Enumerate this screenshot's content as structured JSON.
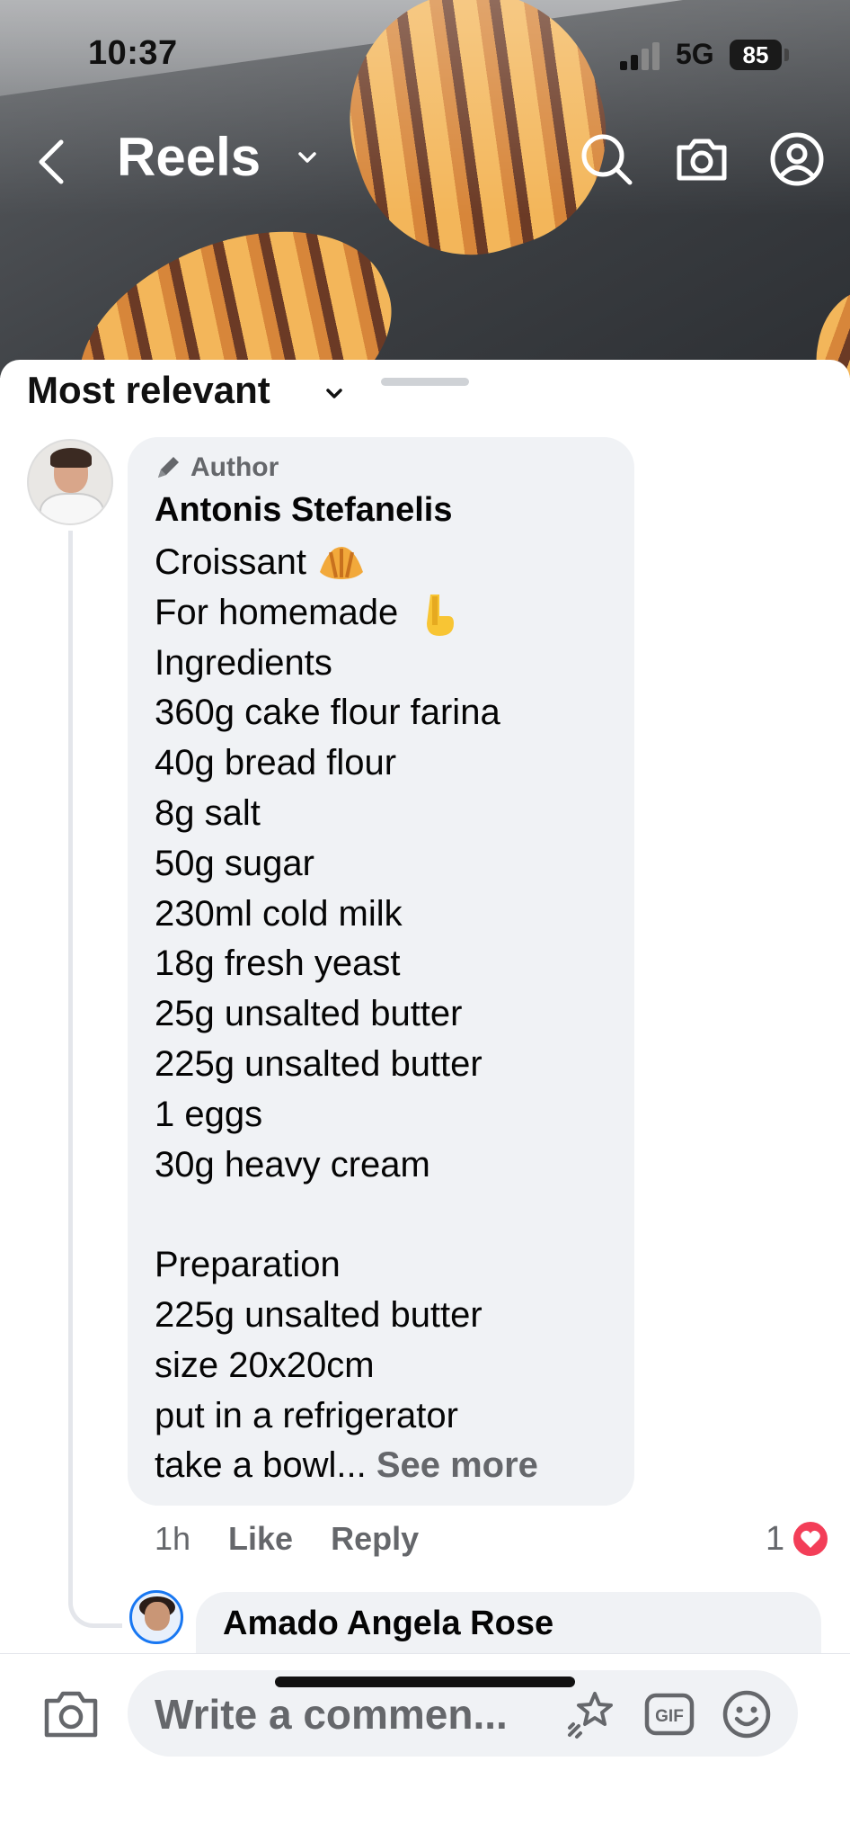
{
  "status_bar": {
    "time": "10:37",
    "network": "5G",
    "battery": "85"
  },
  "header": {
    "title": "Reels"
  },
  "comments": {
    "sort_label": "Most relevant",
    "main": {
      "badge": "Author",
      "name": "Antonis Stefanelis",
      "lines": [
        "Croissant",
        "For homemade",
        "Ingredients",
        "360g cake flour farina",
        "40g bread flour",
        "8g salt",
        "50g sugar",
        "230ml cold milk",
        "18g fresh yeast",
        "25g unsalted butter",
        "225g unsalted butter",
        "1 eggs",
        "30g heavy cream",
        "",
        "Preparation",
        "225g unsalted butter",
        "size 20x20cm",
        "put in a refrigerator",
        "take a bowl..."
      ],
      "see_more": "See more",
      "time_ago": "1h",
      "like_label": "Like",
      "reply_label": "Reply",
      "reaction_count": "1"
    },
    "reply": {
      "name": "Amado Angela Rose"
    }
  },
  "composer": {
    "placeholder": "Write a commen...",
    "gif_label": "GIF"
  },
  "colors": {
    "bubble": "#f0f2f5",
    "muted": "#65676b",
    "heart": "#f33e58"
  }
}
